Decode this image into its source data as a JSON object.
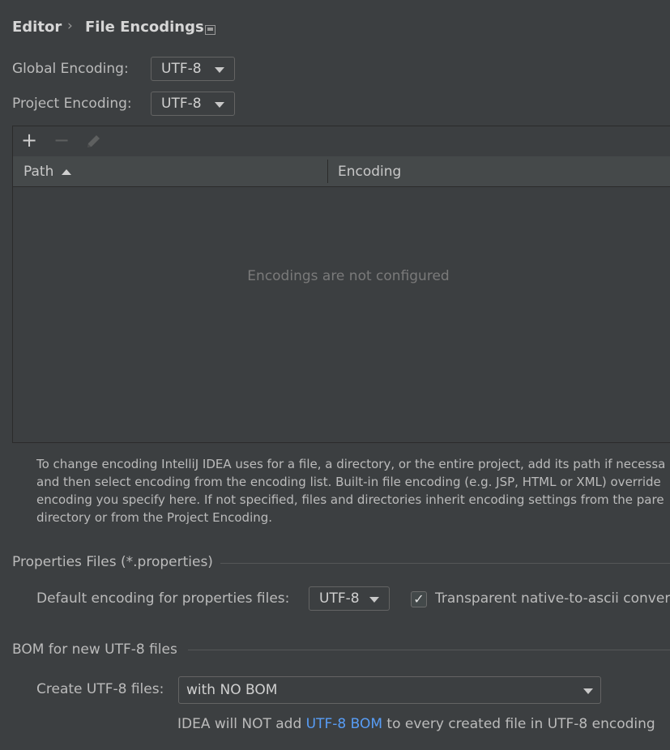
{
  "breadcrumb": {
    "parent": "Editor",
    "separator": "›",
    "current": "File Encodings",
    "icon": "pin-icon"
  },
  "global_encoding": {
    "label": "Global Encoding:",
    "value": "UTF-8"
  },
  "project_encoding": {
    "label": "Project Encoding:",
    "value": "UTF-8"
  },
  "table": {
    "toolbar": {
      "add": "+",
      "remove": "−",
      "edit": "pencil-icon"
    },
    "columns": [
      {
        "label": "Path",
        "sort": "ascending"
      },
      {
        "label": "Encoding"
      }
    ],
    "empty_text": "Encodings are not configured"
  },
  "help": {
    "line1": "To change encoding IntelliJ IDEA uses for a file, a directory, or the entire project, add its path if necessa",
    "line2": "and then select encoding from the encoding list. Built-in file encoding (e.g. JSP, HTML or XML) override",
    "line3": "encoding you specify here. If not specified, files and directories inherit encoding settings from the pare",
    "line4": "directory or from the Project Encoding."
  },
  "properties": {
    "title": "Properties Files (*.properties)",
    "default_label": "Default encoding for properties files:",
    "default_value": "UTF-8",
    "checkbox_checked": true,
    "checkbox_label": "Transparent native-to-ascii conver"
  },
  "bom": {
    "title": "BOM for new UTF-8 files",
    "create_label": "Create UTF-8 files:",
    "create_value": "with NO BOM",
    "note_prefix": "IDEA will NOT add ",
    "note_link": "UTF-8 BOM",
    "note_suffix": " to every created file in UTF-8 encoding"
  }
}
